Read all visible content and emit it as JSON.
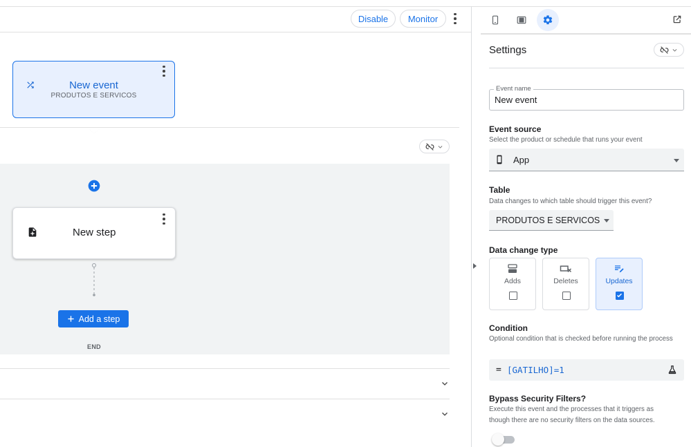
{
  "toolbar": {
    "disable_label": "Disable",
    "monitor_label": "Monitor"
  },
  "canvas": {
    "event_card": {
      "title": "New event",
      "subtitle": "PRODUTOS E SERVICOS"
    },
    "step_card": {
      "title": "New step"
    },
    "add_step_label": "Add a step",
    "end_label": "END"
  },
  "panel": {
    "tabs": [
      "phone-icon",
      "tablet-icon",
      "settings-gear-icon"
    ],
    "active_tab": "settings-gear-icon",
    "title": "Settings",
    "event_name": {
      "label": "Event name",
      "value": "New event"
    },
    "event_source": {
      "title": "Event source",
      "description": "Select the product or schedule that runs your event",
      "value": "App"
    },
    "table": {
      "title": "Table",
      "description": "Data changes to which table should trigger this event?",
      "value": "PRODUTOS E SERVICOS"
    },
    "data_change_type": {
      "title": "Data change type",
      "options": [
        {
          "label": "Adds",
          "checked": false
        },
        {
          "label": "Deletes",
          "checked": false
        },
        {
          "label": "Updates",
          "checked": true
        }
      ]
    },
    "condition": {
      "title": "Condition",
      "description": "Optional condition that is checked before running the process",
      "prefix": "=",
      "expression": "[GATILHO]=1"
    },
    "bypass": {
      "title": "Bypass Security Filters?",
      "description": "Execute this event and the processes that it triggers as though there are no security filters on the data sources.",
      "enabled": false
    }
  },
  "colors": {
    "accent": "#1a73e8",
    "selected_bg": "#e8f0fe",
    "canvas_bg": "#f1f3f4"
  }
}
